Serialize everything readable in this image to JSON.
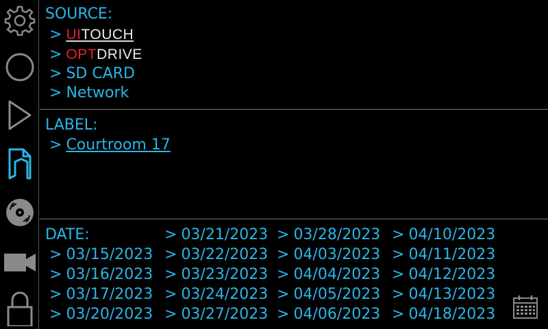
{
  "sidebar": {
    "items": [
      {
        "name": "gear-icon"
      },
      {
        "name": "record-icon"
      },
      {
        "name": "play-icon"
      },
      {
        "name": "folder-icon"
      },
      {
        "name": "disc-icon"
      },
      {
        "name": "camera-icon"
      },
      {
        "name": "lock-icon"
      }
    ],
    "active_index": 3
  },
  "source": {
    "heading": "SOURCE:",
    "arrow": ">",
    "uitouch": {
      "red": "UI",
      "white": "TOUCH"
    },
    "optdrive": {
      "red": "OPT",
      "white": "DRIVE"
    },
    "sd_card": "SD CARD",
    "network": "Network"
  },
  "label": {
    "heading": "LABEL:",
    "arrow": ">",
    "value": "Courtroom 17"
  },
  "date": {
    "heading": "DATE:",
    "arrow": ">",
    "col1": [
      "03/15/2023",
      "03/16/2023",
      "03/17/2023",
      "03/20/2023"
    ],
    "col2": [
      "03/21/2023",
      "03/22/2023",
      "03/23/2023",
      "03/24/2023",
      "03/27/2023"
    ],
    "col3": [
      "03/28/2023",
      "04/03/2023",
      "04/04/2023",
      "04/05/2023",
      "04/06/2023"
    ],
    "col4": [
      "04/10/2023",
      "04/11/2023",
      "04/12/2023",
      "04/13/2023",
      "04/18/2023"
    ]
  },
  "colors": {
    "accent": "#29b6e6",
    "icon_gray": "#8a8a8a",
    "brand_red": "#e3232b"
  }
}
